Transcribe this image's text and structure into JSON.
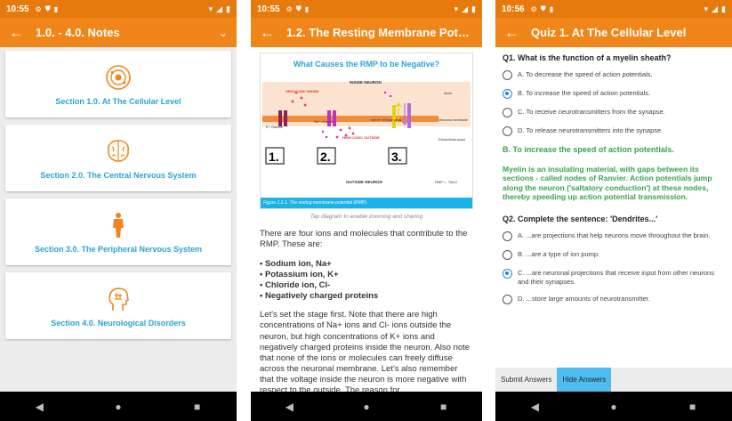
{
  "screens": [
    {
      "status_time": "10:55",
      "title": "1.0. - 4.0. Notes",
      "sections": [
        {
          "label": "Section 1.0. At The Cellular Level",
          "icon": "cell-icon"
        },
        {
          "label": "Section 2.0. The Central Nervous System",
          "icon": "brain-icon"
        },
        {
          "label": "Section 3.0. The Peripheral Nervous System",
          "icon": "body-icon"
        },
        {
          "label": "Section 4.0. Neurological Disorders",
          "icon": "head-brain-icon"
        }
      ]
    },
    {
      "status_time": "10:55",
      "title": "1.2. The Resting Membrane Potenti...",
      "diagram": {
        "title": "What Causes the RMP to be Negative?",
        "inside": "INSIDE NEURON",
        "outside": "OUTSIDE NEURON",
        "axon": "Axon",
        "membrane": "Neuronal membrane",
        "extra": "Extracellular space",
        "high_in": "HIGH CONC INSIDE",
        "high_out": "HIGH CONC OUTSIDE",
        "k_channel": "K+ channel",
        "na_channel": "Na+ channel",
        "pump": "Na+/K+ ATPase pump",
        "rmp": "RMP = -70mV",
        "num1": "1.",
        "num2": "2.",
        "num3": "3.",
        "caption": "Figure 1.2.1. The resting membrane potential (RMP)."
      },
      "hint": "Tap diagram to enable zooming and sharing",
      "intro": "There are four ions and molecules that contribute to the RMP. These are:",
      "bullets": [
        "• Sodium ion, Na+",
        "• Potassium ion, K+",
        "• Chloride ion, Cl-",
        "• Negatively charged proteins"
      ],
      "body": "Let's set the stage first. Note that there are high concentrations of Na+ ions and Cl- ions outside the neuron, but high concentrations of K+ ions and negatively charged proteins inside the neuron. Also note that none of the ions or molecules can freely diffuse across the neuronal membrane. Let's also remember that the voltage inside the neuron is more negative with respect to the outside. The reason for"
    },
    {
      "status_time": "10:56",
      "title": "Quiz 1. At The Cellular Level",
      "q1": "Q1. What is the function of a myelin sheath?",
      "q1_options": [
        "A. To decrease the speed of action potentials.",
        "B. To increase the speed of action potentials.",
        "C. To receive neurotransmitters from the synapse.",
        "D. To release neurotransmitters into the synapse."
      ],
      "q1_selected": 1,
      "answer": "B. To increase the speed of action potentials.",
      "explanation": "Myelin is an insulating material, with gaps between its sections - called nodes of Ranvier. Action potentials jump along the neuron ('saltatory conduction') at these nodes, thereby speeding up action potential transmission.",
      "q2": "Q2. Complete the sentence: 'Dendrites...'",
      "q2_options": [
        "A. ...are projections that help neurons move throughout the brain.",
        "B. ...are a type of ion pump.",
        "C. ...are neuronal projections that receive input from other neurons and their synapses.",
        "D. ...store large amounts of neurotransmitter."
      ],
      "q2_selected": 2,
      "submit": "Submit Answers",
      "hide": "Hide Answers"
    }
  ],
  "colors": {
    "statusbar": "#e77a0c",
    "appbar": "#f08519",
    "link": "#2aa3d8",
    "answer": "#3aa34b",
    "active_button": "#50bdf0"
  }
}
